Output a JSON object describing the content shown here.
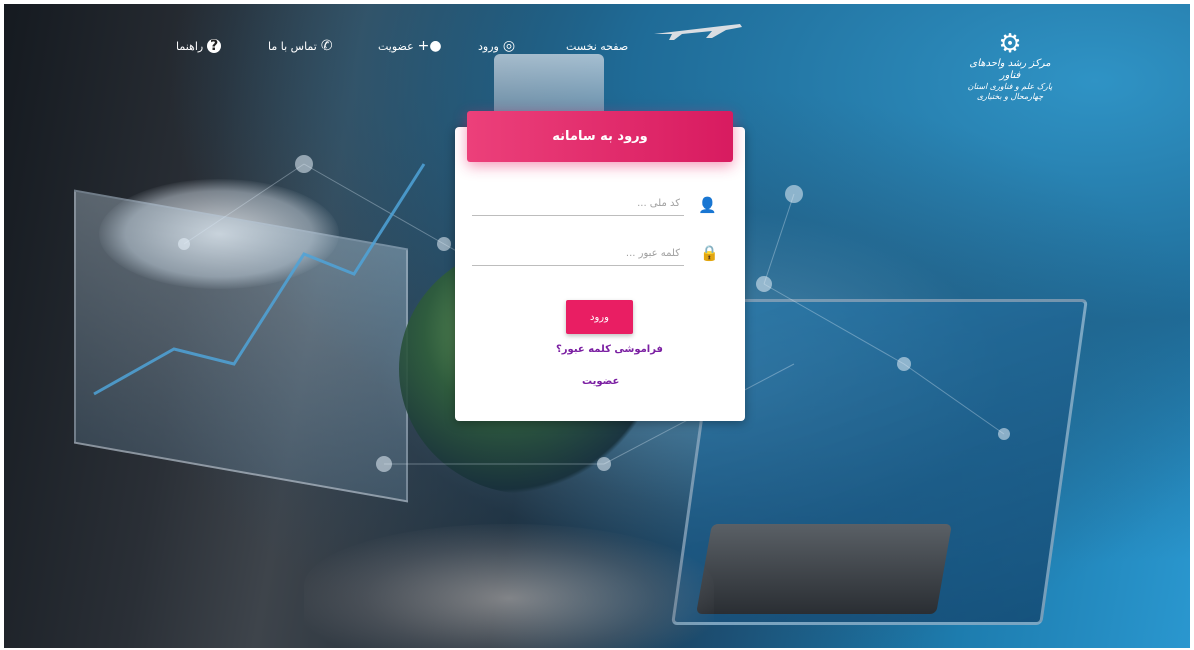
{
  "header": {
    "logo": {
      "line1": "مرکز رشد واحدهای فناور",
      "line2": "پارک علم و فناوری استان چهارمحال و بختیاری"
    },
    "nav": [
      {
        "label": "صفحه نخست",
        "icon": "grid-home-icon"
      },
      {
        "label": "ورود",
        "icon": "fingerprint-icon"
      },
      {
        "label": "عضویت",
        "icon": "user-plus-icon"
      },
      {
        "label": "تماس با ما",
        "icon": "phone-icon"
      },
      {
        "label": "راهنما",
        "icon": "question-circle-icon"
      }
    ]
  },
  "login": {
    "title": "ورود به سامانه",
    "national_code_placeholder": "کد ملی ...",
    "password_placeholder": "کلمه عبور ...",
    "submit_label": "ورود",
    "forgot_link": "فراموشی کلمه عبور؟",
    "register_link": "عضویت"
  },
  "colors": {
    "accent": "#e91e63",
    "link": "#7b1fa2"
  }
}
